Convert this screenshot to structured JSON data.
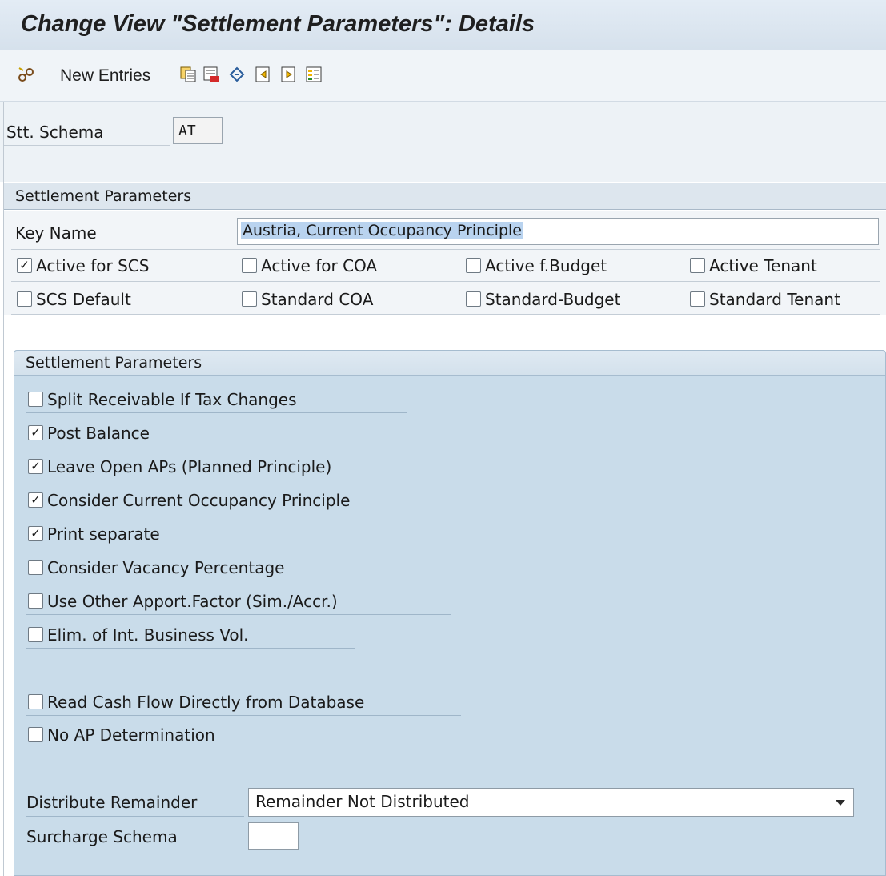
{
  "window": {
    "title": "Change View \"Settlement Parameters\": Details"
  },
  "toolbar": {
    "items": [
      {
        "icon": "edit-glasses-icon"
      },
      {
        "label": "New Entries"
      },
      {
        "icon": "copy-icon"
      },
      {
        "icon": "delete-icon"
      },
      {
        "icon": "undo-change-icon"
      },
      {
        "icon": "previous-entry-icon"
      },
      {
        "icon": "next-entry-icon"
      },
      {
        "icon": "variable-list-icon"
      }
    ]
  },
  "header": {
    "schema_label": "Stt. Schema",
    "schema_value": "AT"
  },
  "settlement_section": {
    "title": "Settlement Parameters",
    "key_name_label": "Key Name",
    "key_name_value": "Austria, Current Occupancy Principle",
    "active_row": [
      {
        "label": "Active for SCS",
        "checked": true
      },
      {
        "label": "Active for COA",
        "checked": false
      },
      {
        "label": "Active f.Budget",
        "checked": false
      },
      {
        "label": "Active Tenant",
        "checked": false
      }
    ],
    "default_row": [
      {
        "label": "SCS Default",
        "checked": false
      },
      {
        "label": "Standard COA",
        "checked": false
      },
      {
        "label": "Standard-Budget",
        "checked": false
      },
      {
        "label": "Standard Tenant",
        "checked": false
      }
    ]
  },
  "parameters_group": {
    "title": "Settlement Parameters",
    "options": [
      {
        "label": "Split Receivable If Tax Changes",
        "checked": false
      },
      {
        "label": "Post Balance",
        "checked": true
      },
      {
        "label": "Leave Open APs (Planned Principle)",
        "checked": true
      },
      {
        "label": "Consider Current Occupancy Principle",
        "checked": true
      },
      {
        "label": "Print separate",
        "checked": true
      },
      {
        "label": "Consider Vacancy Percentage",
        "checked": false
      },
      {
        "label": "Use Other Apport.Factor (Sim./Accr.)",
        "checked": false
      },
      {
        "label": "Elim. of Int. Business Vol.",
        "checked": false
      },
      {
        "label": "Read Cash Flow Directly from Database",
        "checked": false
      },
      {
        "label": "No AP Determination",
        "checked": false
      }
    ],
    "distribute_remainder_label": "Distribute Remainder",
    "distribute_remainder_value": "Remainder Not Distributed",
    "surcharge_schema_label": "Surcharge Schema",
    "surcharge_schema_value": ""
  },
  "check_mark": "✓"
}
